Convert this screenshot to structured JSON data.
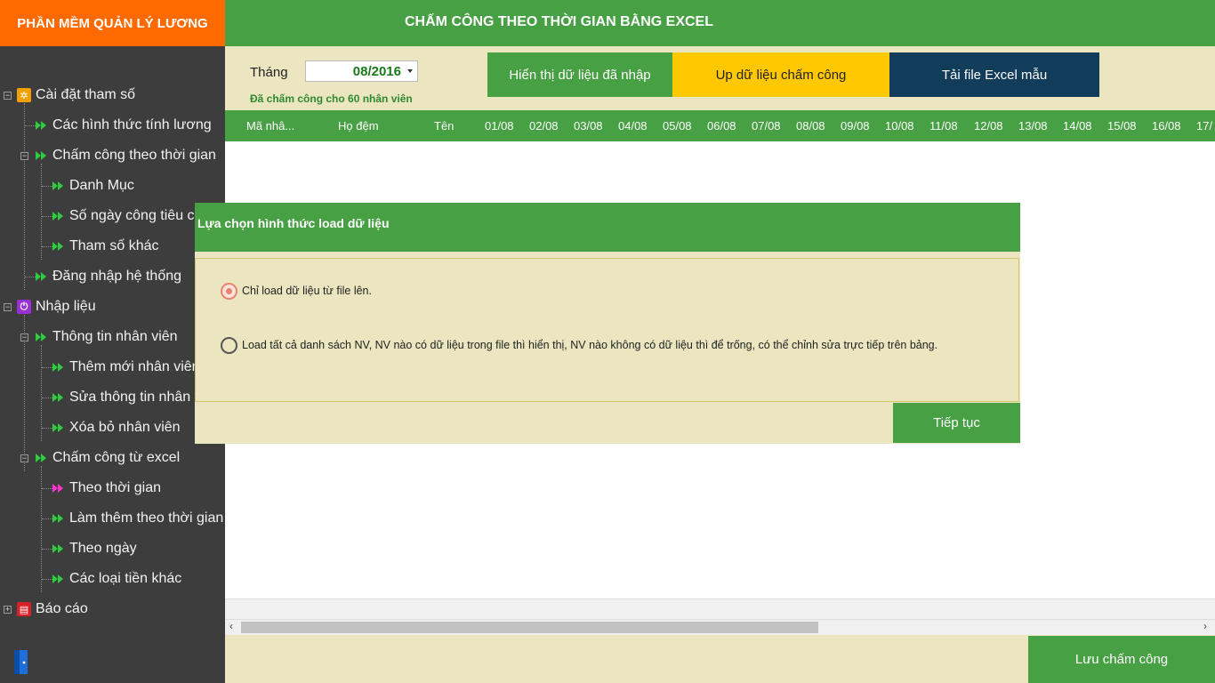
{
  "app": {
    "title": "PHẦN MỀM QUẢN LÝ LƯƠNG",
    "page_title": "CHẤM CÔNG THEO THỜI GIAN BẰNG EXCEL"
  },
  "sidebar": {
    "items": [
      {
        "label": "Cài đặt tham số"
      },
      {
        "label": "Các hình thức tính lương"
      },
      {
        "label": "Chấm công theo thời gian"
      },
      {
        "label": "Danh Mục"
      },
      {
        "label": "Số ngày công tiêu chuẩn"
      },
      {
        "label": "Tham số khác"
      },
      {
        "label": "Đăng nhập hệ thống"
      },
      {
        "label": "Nhập liệu"
      },
      {
        "label": "Thông tin nhân viên"
      },
      {
        "label": "Thêm mới nhân viên"
      },
      {
        "label": "Sửa thông tin nhân viên"
      },
      {
        "label": "Xóa bỏ nhân viên"
      },
      {
        "label": "Chấm công từ excel"
      },
      {
        "label": "Theo thời gian"
      },
      {
        "label": "Làm thêm theo thời gian"
      },
      {
        "label": "Theo ngày"
      },
      {
        "label": "Các loại tiền khác"
      },
      {
        "label": "Báo cáo"
      }
    ]
  },
  "toolbar": {
    "month_label": "Tháng",
    "month_value": "08/2016",
    "status": "Đã chấm công cho 60 nhân viên",
    "show_label": "Hiển thị dữ liệu đã nhập",
    "upload_label": "Up dữ liệu chấm công",
    "template_label": "Tải file Excel mẫu"
  },
  "grid": {
    "columns": [
      "Mã nhâ...",
      "Họ đệm",
      "Tên",
      "01/08",
      "02/08",
      "03/08",
      "04/08",
      "05/08",
      "06/08",
      "07/08",
      "08/08",
      "09/08",
      "10/08",
      "11/08",
      "12/08",
      "13/08",
      "14/08",
      "15/08",
      "16/08",
      "17/"
    ]
  },
  "dialog": {
    "title": "Lựa chọn hình thức load dữ liệu",
    "option1": "Chỉ load dữ liệu từ file lên.",
    "option2": "Load tất cả danh sách NV, NV nào có dữ liệu trong file thì hiển thị, NV nào không có dữ liệu thì để trống, có thể chỉnh sửa trực tiếp trên bảng.",
    "continue_label": "Tiếp tục"
  },
  "bottom": {
    "save_label": "Lưu chấm công"
  },
  "colors": {
    "green": "#48a044",
    "orange": "#ff6a00",
    "yellow": "#ffc800",
    "navy": "#113c5a",
    "beige": "#ebe6c0",
    "sidebar": "#3d3d3d"
  }
}
